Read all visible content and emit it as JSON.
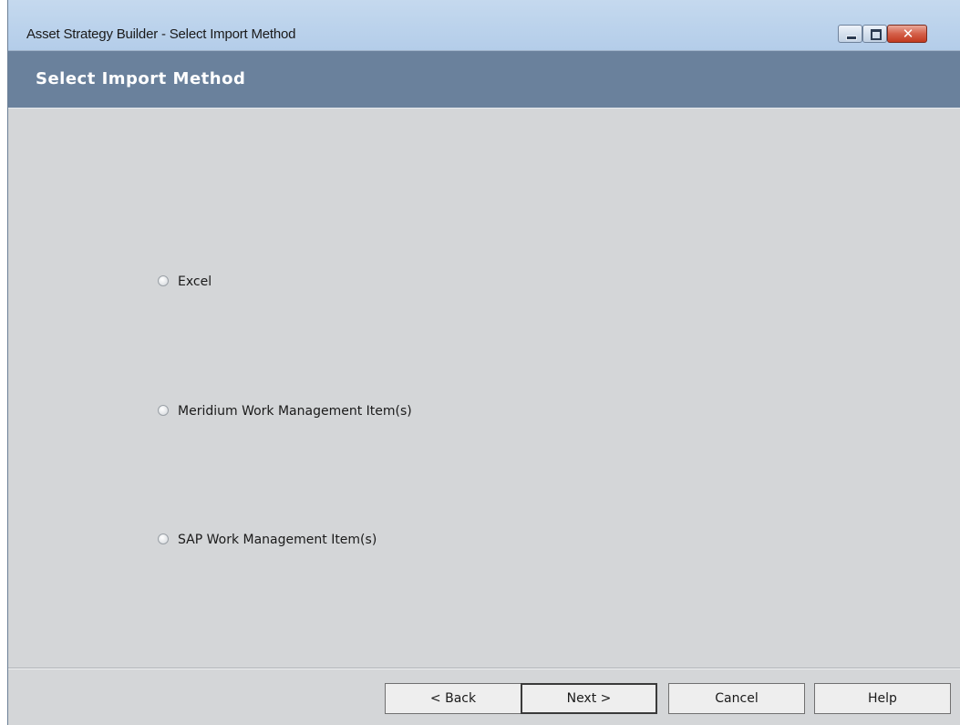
{
  "window": {
    "title": "Asset Strategy Builder - Select Import Method"
  },
  "header": {
    "title": "Select Import Method"
  },
  "import_options": [
    {
      "label": "Excel",
      "selected": false
    },
    {
      "label": "Meridium Work Management Item(s)",
      "selected": false
    },
    {
      "label": "SAP Work Management Item(s)",
      "selected": false
    }
  ],
  "footer": {
    "back_label": "< Back",
    "next_label": "Next >",
    "cancel_label": "Cancel",
    "help_label": "Help"
  },
  "colors": {
    "header_band": "#6a819c",
    "body_background": "#d4d6d8"
  }
}
